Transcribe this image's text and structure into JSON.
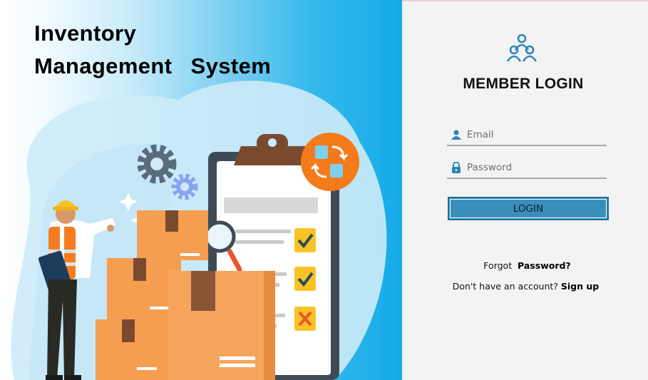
{
  "hero": {
    "title_line1": "Inventory",
    "title_line2": "Management  System"
  },
  "login": {
    "heading": "MEMBER LOGIN",
    "email_placeholder": "Email",
    "password_placeholder": "Password",
    "login_button": "LOGIN",
    "forgot_prefix": "Forgot",
    "forgot_link": "Password?",
    "signup_prefix": "Don't have an account?",
    "signup_link": "Sign up"
  },
  "icons": {
    "user_group": "users-icon",
    "email_field": "user-icon",
    "password_field": "lock-icon"
  },
  "colors": {
    "accent": "#3a8fba",
    "accent_border": "#1f6fa3",
    "icon_blue": "#2f86b6",
    "panel_bg": "#f3f3f3",
    "hero_blue": "#14aae8",
    "box_orange": "#f59e52",
    "badge_orange": "#f47b1a",
    "check_yellow": "#f7c325"
  }
}
